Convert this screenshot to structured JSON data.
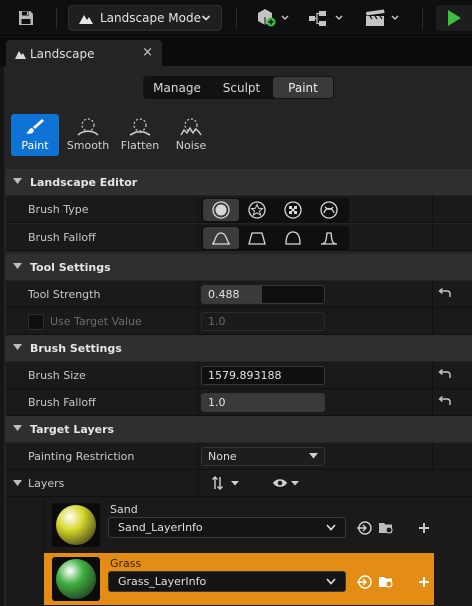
{
  "toolbar": {
    "mode_label": "Landscape Mode"
  },
  "panel_tab": {
    "title": "Landscape",
    "close": "×"
  },
  "mode_tabs": [
    {
      "label": "Manage",
      "active": false
    },
    {
      "label": "Sculpt",
      "active": false
    },
    {
      "label": "Paint",
      "active": true
    }
  ],
  "tools": [
    {
      "label": "Paint",
      "icon": "brush-icon",
      "active": true
    },
    {
      "label": "Smooth",
      "icon": "smooth-icon",
      "active": false
    },
    {
      "label": "Flatten",
      "icon": "flatten-icon",
      "active": false
    },
    {
      "label": "Noise",
      "icon": "noise-icon",
      "active": false
    }
  ],
  "sections": {
    "landscape_editor": "Landscape Editor",
    "tool_settings": "Tool Settings",
    "brush_settings": "Brush Settings",
    "target_layers": "Target Layers"
  },
  "landscape_editor": {
    "brush_type_label": "Brush Type",
    "brush_falloff_label": "Brush Falloff"
  },
  "tool_settings": {
    "tool_strength_label": "Tool Strength",
    "tool_strength_value": "0.488",
    "tool_strength_fraction": 0.488,
    "use_target_value_label": "Use Target Value",
    "use_target_value": "1.0"
  },
  "brush_settings": {
    "brush_size_label": "Brush Size",
    "brush_size_value": "1579.893188",
    "brush_falloff_label": "Brush Falloff",
    "brush_falloff_value": "1.0"
  },
  "target_layers": {
    "painting_restriction_label": "Painting Restriction",
    "painting_restriction_value": "None",
    "layers_label": "Layers"
  },
  "layers": [
    {
      "name": "Sand",
      "info": "Sand_LayerInfo",
      "color": "#d6d62a",
      "selected": false
    },
    {
      "name": "Grass",
      "info": "Grass_LayerInfo",
      "color": "#3fae3f",
      "selected": true
    }
  ],
  "colors": {
    "accent_blue": "#0f73d6",
    "selected_layer": "#e38d15",
    "play_green": "#3fbf3f"
  }
}
